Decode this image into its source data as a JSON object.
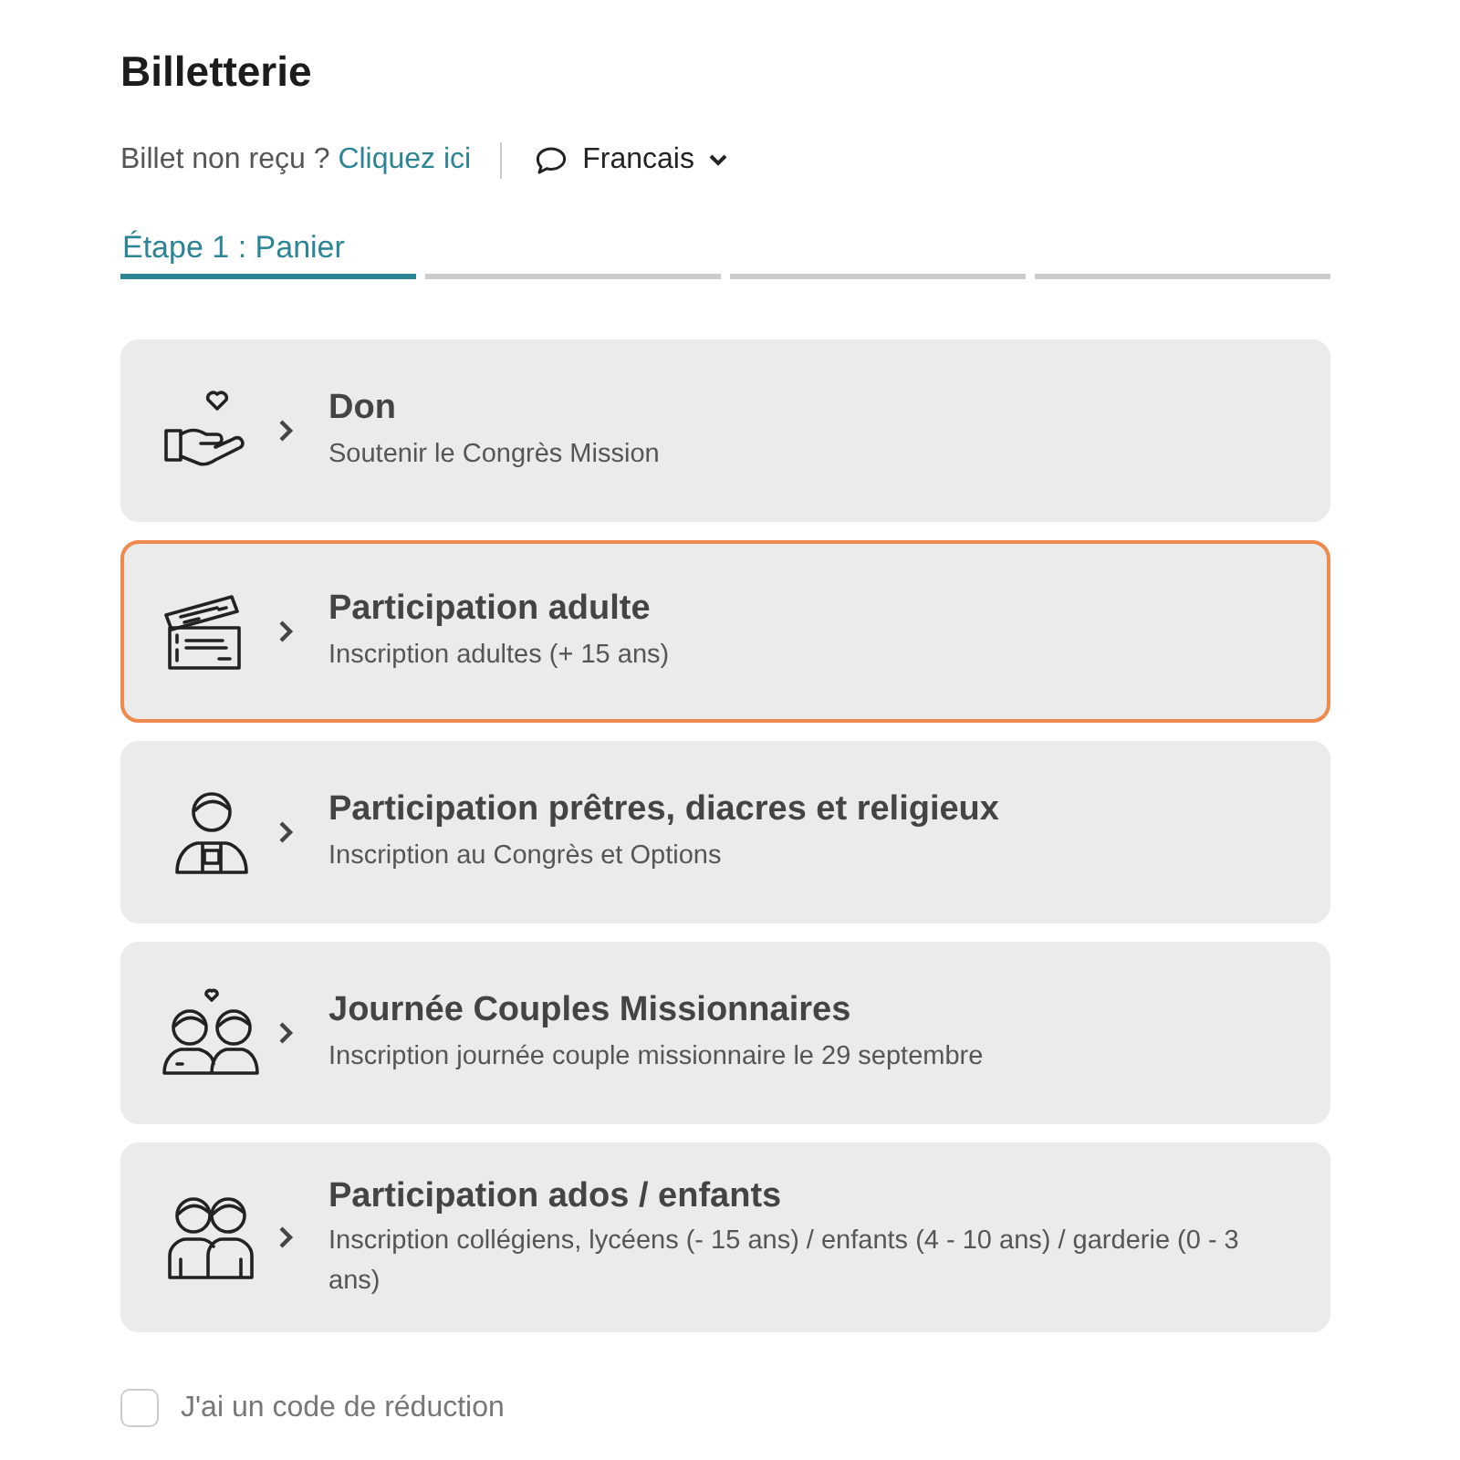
{
  "title": "Billetterie",
  "help": {
    "text": "Billet non reçu ?",
    "link": "Cliquez ici"
  },
  "language": {
    "label": "Francais"
  },
  "steps": [
    {
      "label": "Étape 1 : Panier",
      "selected": true
    },
    {
      "selected": false
    },
    {
      "selected": false
    },
    {
      "selected": false
    }
  ],
  "tickets": [
    {
      "kind": "donation",
      "title": "Don",
      "subtitle": "Soutenir le Congrès Mission",
      "selected": false
    },
    {
      "kind": "tickets",
      "title": "Participation adulte",
      "subtitle": "Inscription adultes (+ 15 ans)",
      "selected": true
    },
    {
      "kind": "priest",
      "title": "Participation prêtres, diacres et religieux",
      "subtitle": "Inscription au Congrès et Options",
      "selected": false
    },
    {
      "kind": "couple",
      "title": "Journée Couples Missionnaires",
      "subtitle": "Inscription journée couple missionnaire le 29 septembre",
      "selected": false
    },
    {
      "kind": "children",
      "title": "Participation ados / enfants",
      "subtitle": "Inscription collégiens, lycéens (- 15 ans) / enfants (4 - 10 ans) / garderie (0 - 3 ans)",
      "selected": false
    }
  ],
  "discount": {
    "label": "J'ai un code de réduction",
    "checked": false
  }
}
